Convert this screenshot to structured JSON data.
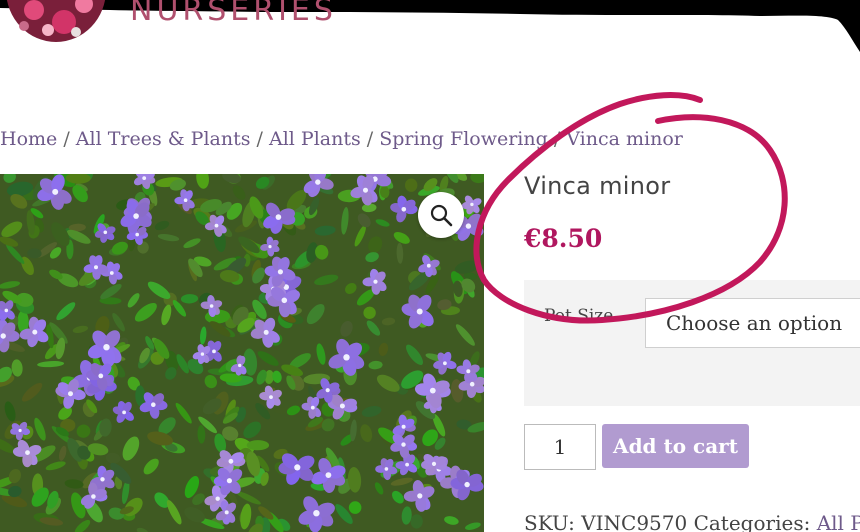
{
  "header": {
    "brand_text": "NURSERIES"
  },
  "breadcrumb": {
    "items": [
      "Home",
      "All Trees & Plants",
      "All Plants",
      "Spring Flowering"
    ],
    "separator": "/",
    "current": "Vinca minor"
  },
  "product": {
    "title": "Vinca minor",
    "price": "€8.50",
    "variation_label": "Pot Size",
    "variation_selected": "Choose an option",
    "quantity": "1",
    "add_to_cart_label": "Add to cart",
    "sku_label": "SKU:",
    "sku_value": "VINC9570",
    "categories_label": "Categories:",
    "categories_value": "All Pla"
  },
  "icons": {
    "zoom": "magnifier-icon"
  },
  "colors": {
    "price": "#b0175f",
    "button": "#b19bd0",
    "brand": "#b0506e",
    "link": "#6e5a8a",
    "annotation": "#c2185b"
  }
}
